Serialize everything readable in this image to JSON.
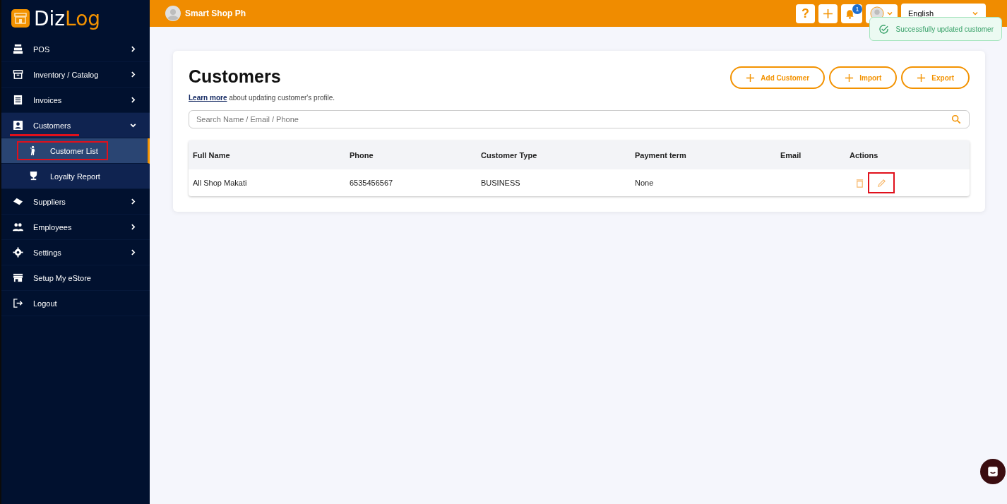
{
  "brand": {
    "name_start": "Diz",
    "name_end": "Log"
  },
  "sidebar": {
    "items": [
      {
        "label": "POS",
        "kind": "menu",
        "expanded": false,
        "annotated": false
      },
      {
        "label": "Inventory / Catalog",
        "kind": "menu",
        "expanded": false,
        "annotated": false
      },
      {
        "label": "Invoices",
        "kind": "menu",
        "expanded": false,
        "annotated": false
      },
      {
        "label": "Customers",
        "kind": "menu",
        "expanded": true,
        "annotated": true,
        "children": [
          {
            "label": "Customer List",
            "selected": true,
            "annotated": true
          },
          {
            "label": "Loyalty Report",
            "selected": false,
            "annotated": false
          }
        ]
      },
      {
        "label": "Suppliers",
        "kind": "menu",
        "expanded": false,
        "annotated": false
      },
      {
        "label": "Employees",
        "kind": "menu",
        "expanded": false,
        "annotated": false
      },
      {
        "label": "Settings",
        "kind": "menu",
        "expanded": false,
        "annotated": false
      },
      {
        "label": "Setup My eStore",
        "kind": "link",
        "annotated": false
      },
      {
        "label": "Logout",
        "kind": "link",
        "annotated": false
      }
    ]
  },
  "topbar": {
    "shop_name": "Smart Shop Ph",
    "help": "?",
    "notification_count": "1",
    "language": "English"
  },
  "toast": {
    "message": "Successfully updated customer"
  },
  "page": {
    "title": "Customers",
    "learn_more": "Learn more",
    "hint": " about updating customer's profile.",
    "buttons": [
      "Add Customer",
      "Import",
      "Export"
    ],
    "search": {
      "placeholder": "Search Name / Email / Phone"
    }
  },
  "table": {
    "columns": [
      "Full Name",
      "Phone",
      "Customer Type",
      "Payment term",
      "Email",
      "Actions"
    ],
    "rows": [
      {
        "cells": [
          "All Shop Makati",
          "6535456567",
          "BUSINESS",
          "None",
          ""
        ],
        "edit_annotated": true
      }
    ]
  }
}
